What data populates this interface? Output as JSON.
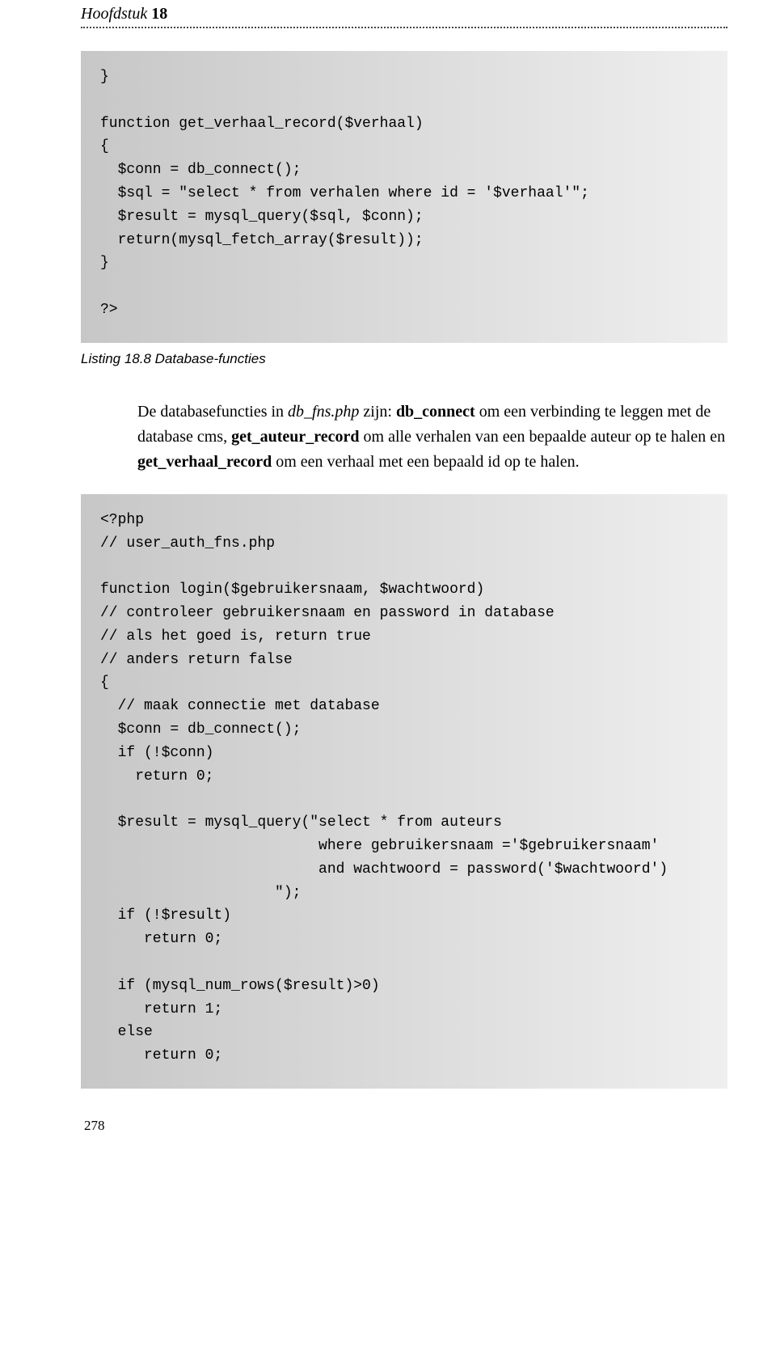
{
  "chapter": {
    "label": "Hoofdstuk",
    "number": "18"
  },
  "code1": "}\n\nfunction get_verhaal_record($verhaal)\n{\n  $conn = db_connect();\n  $sql = \"select * from verhalen where id = '$verhaal'\";\n  $result = mysql_query($sql, $conn);\n  return(mysql_fetch_array($result));\n}\n\n?>",
  "caption": "Listing 18.8 Database-functies",
  "paragraph_parts": {
    "p1": "De databasefuncties in ",
    "p2": "db_fns.php",
    "p3": " zijn: ",
    "p4": "db_connect",
    "p5": " om een verbinding te leggen met de database cms, ",
    "p6": "get_auteur_record",
    "p7": " om alle verhalen van een bepaalde auteur op te halen en ",
    "p8": "get_verhaal_record",
    "p9": " om een verhaal met een bepaald id op te halen."
  },
  "code2": "<?php\n// user_auth_fns.php\n\nfunction login($gebruikersnaam, $wachtwoord)\n// controleer gebruikersnaam en password in database\n// als het goed is, return true\n// anders return false\n{\n  // maak connectie met database\n  $conn = db_connect();\n  if (!$conn)\n    return 0;\n\n  $result = mysql_query(\"select * from auteurs\n                         where gebruikersnaam ='$gebruikersnaam'\n                         and wachtwoord = password('$wachtwoord')\n                    \");\n  if (!$result)\n     return 0;\n\n  if (mysql_num_rows($result)>0)\n     return 1;\n  else\n     return 0;",
  "page_number": "278"
}
